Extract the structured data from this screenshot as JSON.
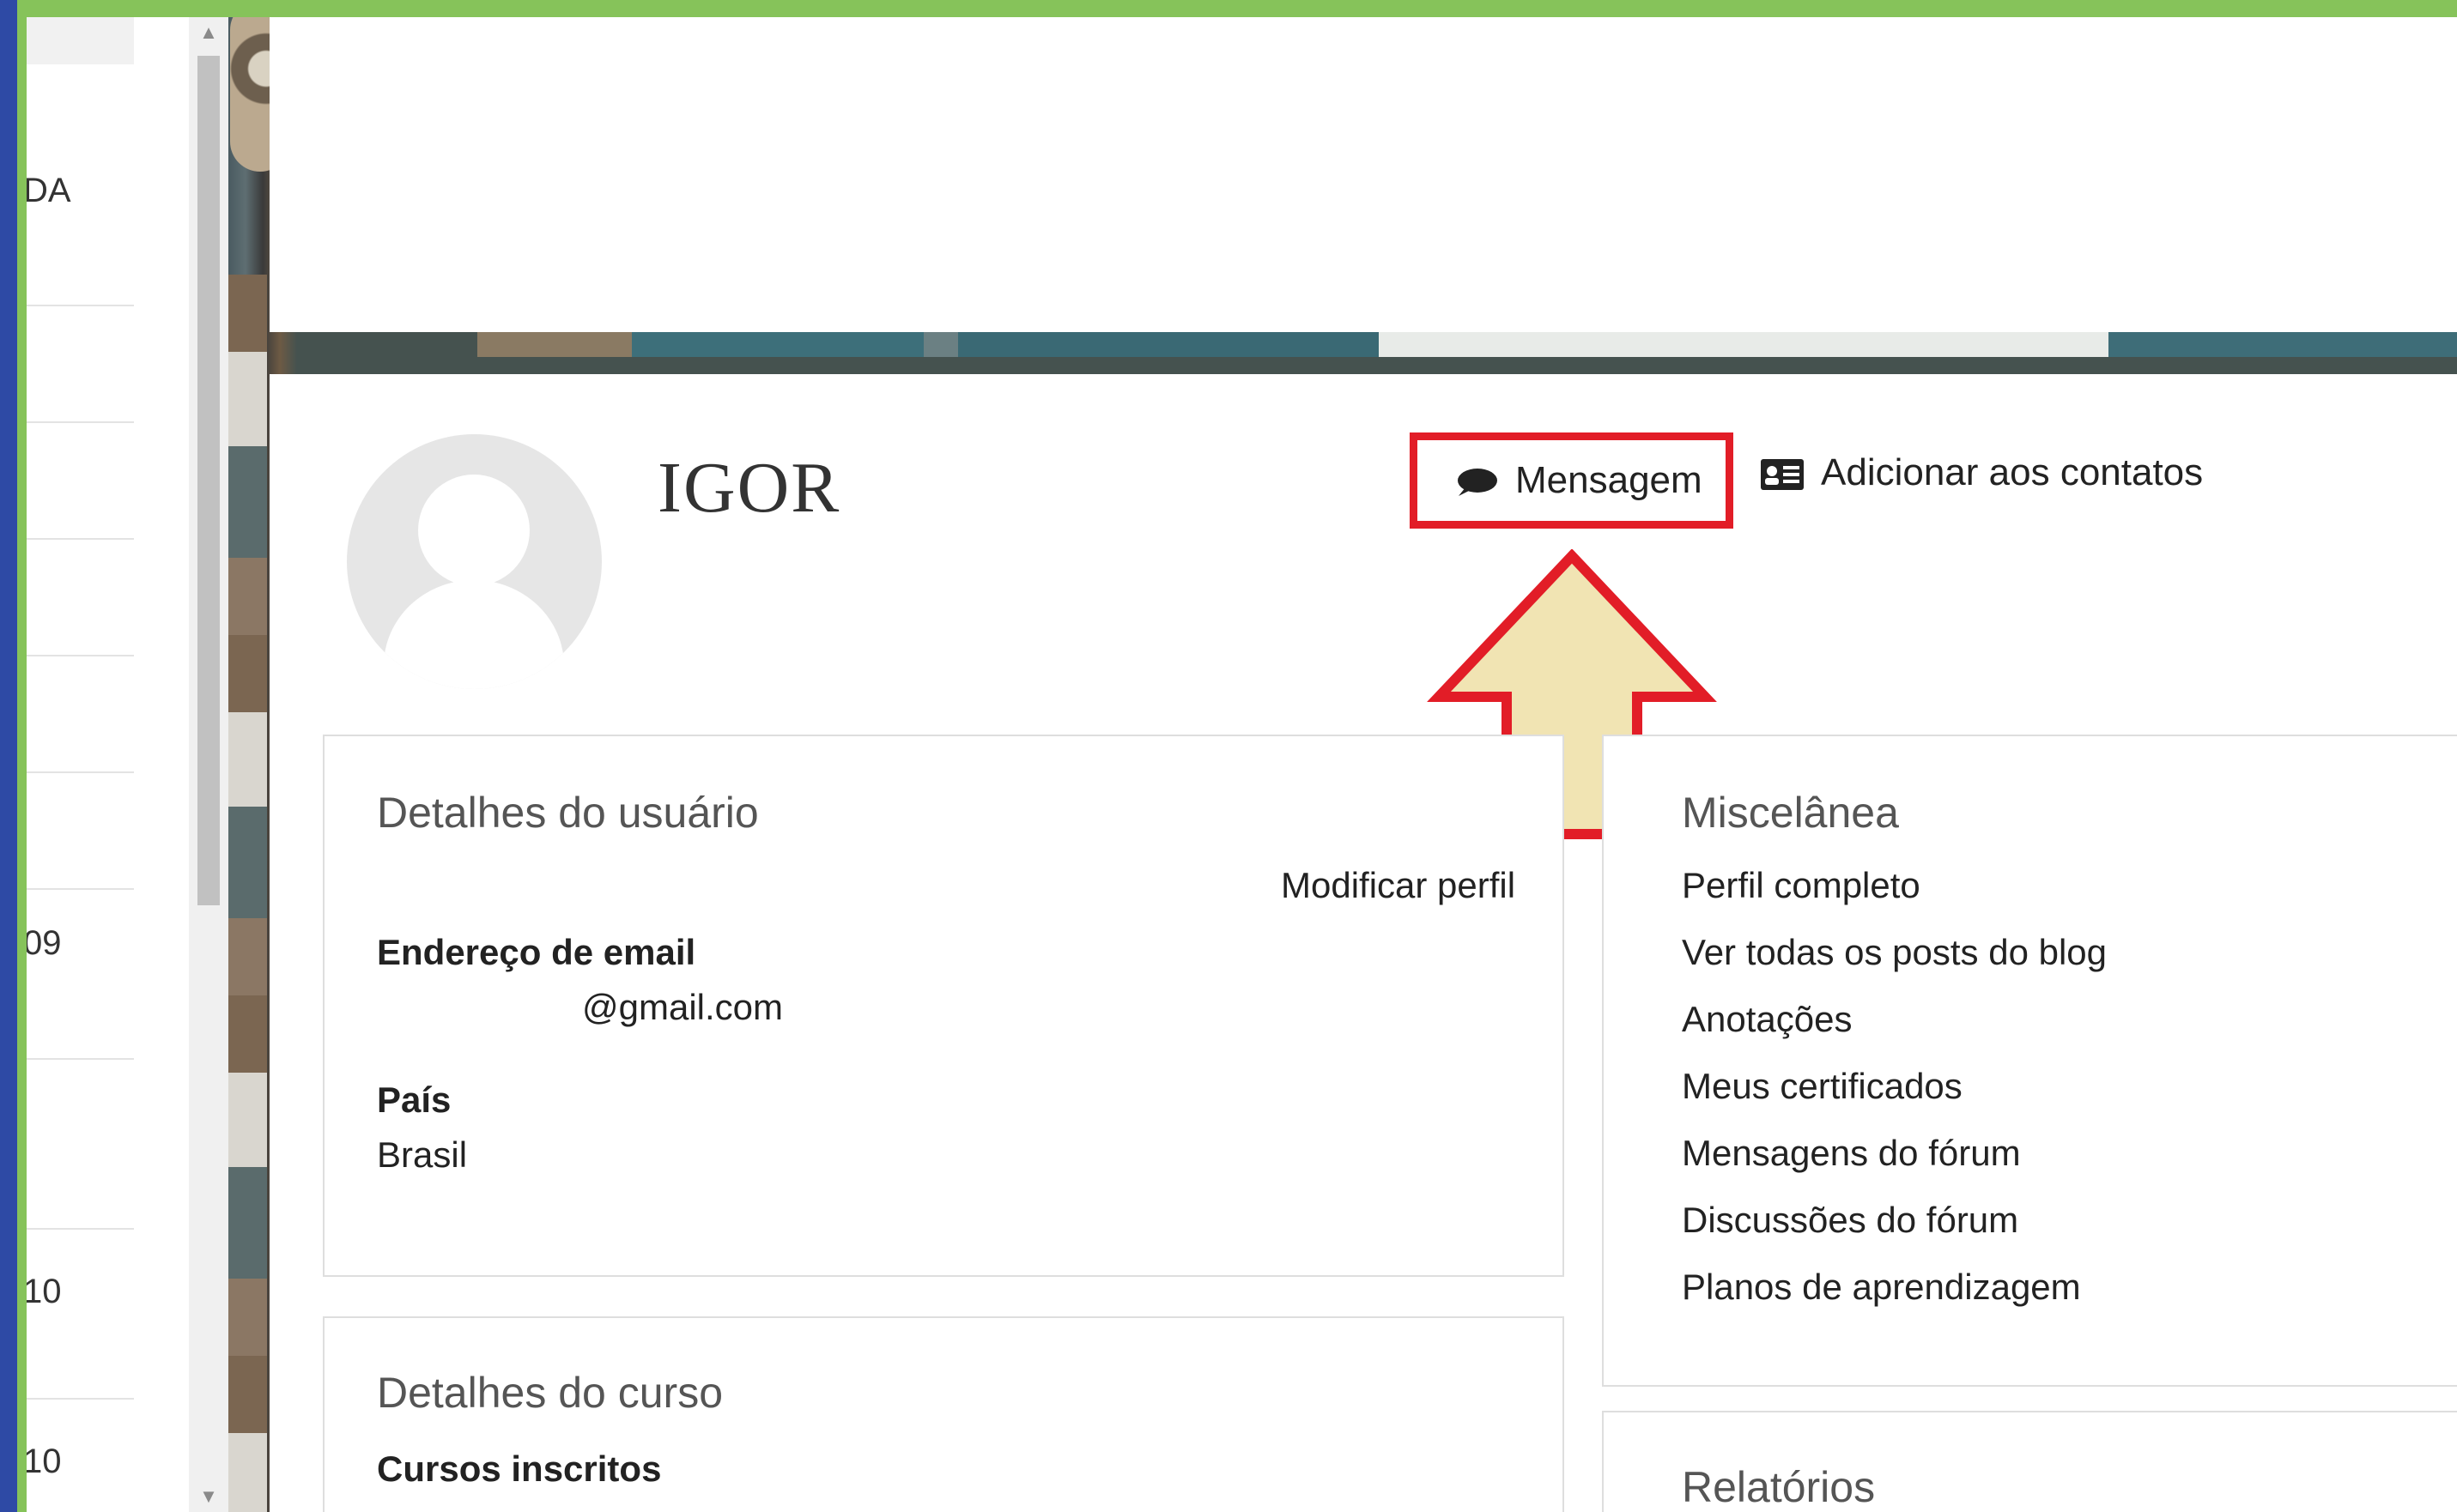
{
  "sidebar": {
    "cells": [
      "DA",
      "",
      "",
      "",
      "",
      "",
      "09",
      "",
      "10",
      "10"
    ]
  },
  "profile": {
    "name": "IGOR",
    "message_button": "Mensagem",
    "add_contacts_button": "Adicionar aos contatos"
  },
  "user_details": {
    "title": "Detalhes do usuário",
    "edit_link": "Modificar perfil",
    "email_label": "Endereço de email",
    "email_value": "@gmail.com",
    "country_label": "País",
    "country_value": "Brasil"
  },
  "course_details": {
    "title": "Detalhes do curso",
    "enrolled_label": "Cursos inscritos"
  },
  "misc": {
    "title": "Miscelânea",
    "links": [
      "Perfil completo",
      "Ver todas os posts do blog",
      "Anotações",
      "Meus certificados",
      "Mensagens do fórum",
      "Discussões do fórum",
      "Planos de aprendizagem"
    ]
  },
  "reports": {
    "title": "Relatórios"
  },
  "colors": {
    "highlight_border": "#e21d27",
    "arrow_fill": "#f1e4b3",
    "frame_green": "#86c35a",
    "frame_blue": "#2e4aa5"
  }
}
